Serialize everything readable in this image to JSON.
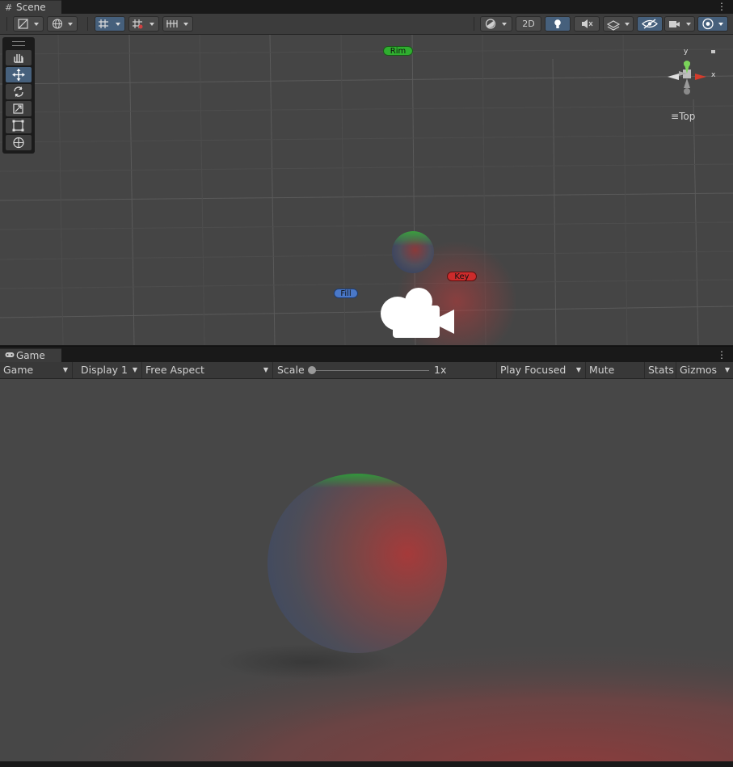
{
  "scene": {
    "tab_label": "Scene",
    "toolbar": {
      "toggle_2d": "2D"
    },
    "tools": [
      "hand",
      "move",
      "rotate",
      "scale",
      "rect",
      "transform"
    ],
    "gizmo": {
      "axis_y": "y",
      "axis_x": "x",
      "view_label": "Top"
    },
    "light_labels": {
      "rim": "Rim",
      "key": "Key",
      "fill": "Fill"
    },
    "colors": {
      "rim": "#2fae2f",
      "key": "#cc2b2b",
      "fill": "#4a78c8"
    }
  },
  "game": {
    "tab_label": "Game",
    "toolbar": {
      "view_mode": "Game",
      "display": "Display 1",
      "aspect": "Free Aspect",
      "scale_label": "Scale",
      "scale_value": "1x",
      "play_mode": "Play Focused",
      "mute_audio": "Mute Audio",
      "stats": "Stats",
      "gizmos": "Gizmos"
    }
  },
  "icons": {
    "menu": "kebab-menu-icon",
    "scene_tab": "hash-icon",
    "game_tab": "gamepad-icon"
  }
}
